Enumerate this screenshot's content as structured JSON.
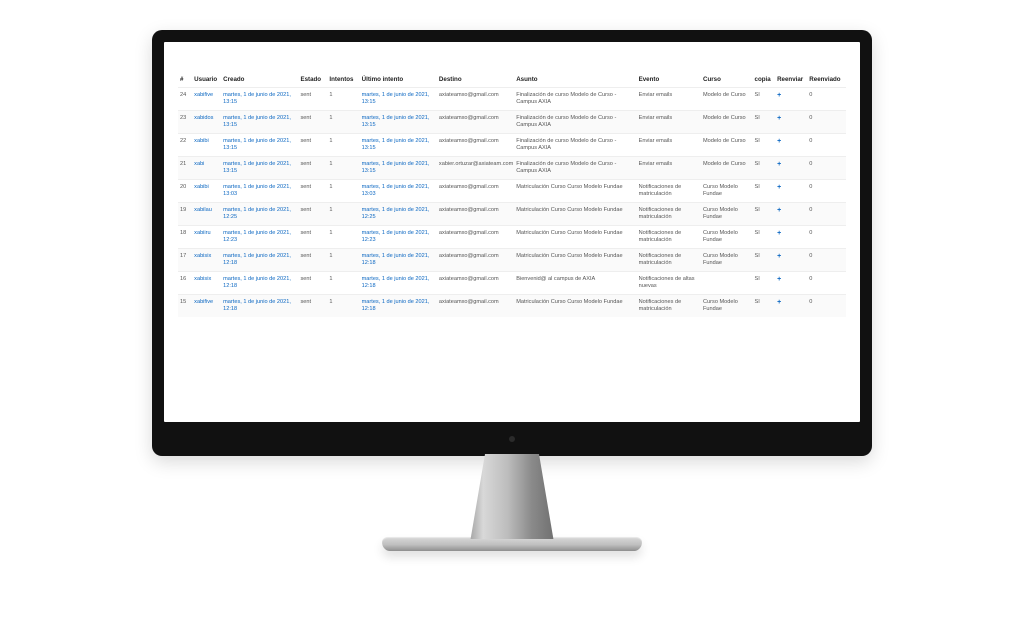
{
  "table": {
    "headers": {
      "num": "#",
      "user": "Usuario",
      "created": "Creado",
      "state": "Estado",
      "attempts": "Intentos",
      "last": "Último intento",
      "dest": "Destino",
      "subject": "Asunto",
      "event": "Evento",
      "course": "Curso",
      "copy": "copia",
      "resend": "Reenviar",
      "resent": "Reenviado"
    },
    "rows": [
      {
        "num": "24",
        "user": "xabifive",
        "created": "martes, 1 de junio de 2021, 13:15",
        "state": "sent",
        "attempts": "1",
        "last": "martes, 1 de junio de 2021, 13:15",
        "dest": "axiateamxo@gmail.com",
        "subject": "Finalización de curso Modelo de Curso - Campus AXIA",
        "event": "Enviar emails",
        "course": "Modelo de Curso",
        "copy": "SI",
        "resend": "+",
        "resent": "0"
      },
      {
        "num": "23",
        "user": "xabidos",
        "created": "martes, 1 de junio de 2021, 13:15",
        "state": "sent",
        "attempts": "1",
        "last": "martes, 1 de junio de 2021, 13:15",
        "dest": "axiateamxo@gmail.com",
        "subject": "Finalización de curso Modelo de Curso - Campus AXIA",
        "event": "Enviar emails",
        "course": "Modelo de Curso",
        "copy": "SI",
        "resend": "+",
        "resent": "0"
      },
      {
        "num": "22",
        "user": "xabibi",
        "created": "martes, 1 de junio de 2021, 13:15",
        "state": "sent",
        "attempts": "1",
        "last": "martes, 1 de junio de 2021, 13:15",
        "dest": "axiateamxo@gmail.com",
        "subject": "Finalización de curso Modelo de Curso - Campus AXIA",
        "event": "Enviar emails",
        "course": "Modelo de Curso",
        "copy": "SI",
        "resend": "+",
        "resent": "0"
      },
      {
        "num": "21",
        "user": "xabi",
        "created": "martes, 1 de junio de 2021, 13:15",
        "state": "sent",
        "attempts": "1",
        "last": "martes, 1 de junio de 2021, 13:15",
        "dest": "xabier.ortuzar@axiateam.com",
        "subject": "Finalización de curso Modelo de Curso - Campus AXIA",
        "event": "Enviar emails",
        "course": "Modelo de Curso",
        "copy": "SI",
        "resend": "+",
        "resent": "0"
      },
      {
        "num": "20",
        "user": "xabibi",
        "created": "martes, 1 de junio de 2021, 13:03",
        "state": "sent",
        "attempts": "1",
        "last": "martes, 1 de junio de 2021, 13:03",
        "dest": "axiateamxo@gmail.com",
        "subject": "Matriculación Curso Curso Modelo Fundae",
        "event": "Notificaciones de matriculación",
        "course": "Curso Modelo Fundae",
        "copy": "SI",
        "resend": "+",
        "resent": "0"
      },
      {
        "num": "19",
        "user": "xabilau",
        "created": "martes, 1 de junio de 2021, 12:25",
        "state": "sent",
        "attempts": "1",
        "last": "martes, 1 de junio de 2021, 12:25",
        "dest": "axiateamxo@gmail.com",
        "subject": "Matriculación Curso Curso Modelo Fundae",
        "event": "Notificaciones de matriculación",
        "course": "Curso Modelo Fundae",
        "copy": "SI",
        "resend": "+",
        "resent": "0"
      },
      {
        "num": "18",
        "user": "xabiiru",
        "created": "martes, 1 de junio de 2021, 12:23",
        "state": "sent",
        "attempts": "1",
        "last": "martes, 1 de junio de 2021, 12:23",
        "dest": "axiateamxo@gmail.com",
        "subject": "Matriculación Curso Curso Modelo Fundae",
        "event": "Notificaciones de matriculación",
        "course": "Curso Modelo Fundae",
        "copy": "SI",
        "resend": "+",
        "resent": "0"
      },
      {
        "num": "17",
        "user": "xabisix",
        "created": "martes, 1 de junio de 2021, 12:18",
        "state": "sent",
        "attempts": "1",
        "last": "martes, 1 de junio de 2021, 12:18",
        "dest": "axiateamxo@gmail.com",
        "subject": "Matriculación Curso Curso Modelo Fundae",
        "event": "Notificaciones de matriculación",
        "course": "Curso Modelo Fundae",
        "copy": "SI",
        "resend": "+",
        "resent": "0"
      },
      {
        "num": "16",
        "user": "xabisix",
        "created": "martes, 1 de junio de 2021, 12:18",
        "state": "sent",
        "attempts": "1",
        "last": "martes, 1 de junio de 2021, 12:18",
        "dest": "axiateamxo@gmail.com",
        "subject": "Bienvenid@ al campus de AXIA",
        "event": "Notificaciones de altas nuevas",
        "course": "",
        "copy": "SI",
        "resend": "+",
        "resent": "0"
      },
      {
        "num": "15",
        "user": "xabifive",
        "created": "martes, 1 de junio de 2021, 12:18",
        "state": "sent",
        "attempts": "1",
        "last": "martes, 1 de junio de 2021, 12:18",
        "dest": "axiateamxo@gmail.com",
        "subject": "Matriculación Curso Curso Modelo Fundae",
        "event": "Notificaciones de matriculación",
        "course": "Curso Modelo Fundae",
        "copy": "SI",
        "resend": "+",
        "resent": "0"
      }
    ]
  }
}
